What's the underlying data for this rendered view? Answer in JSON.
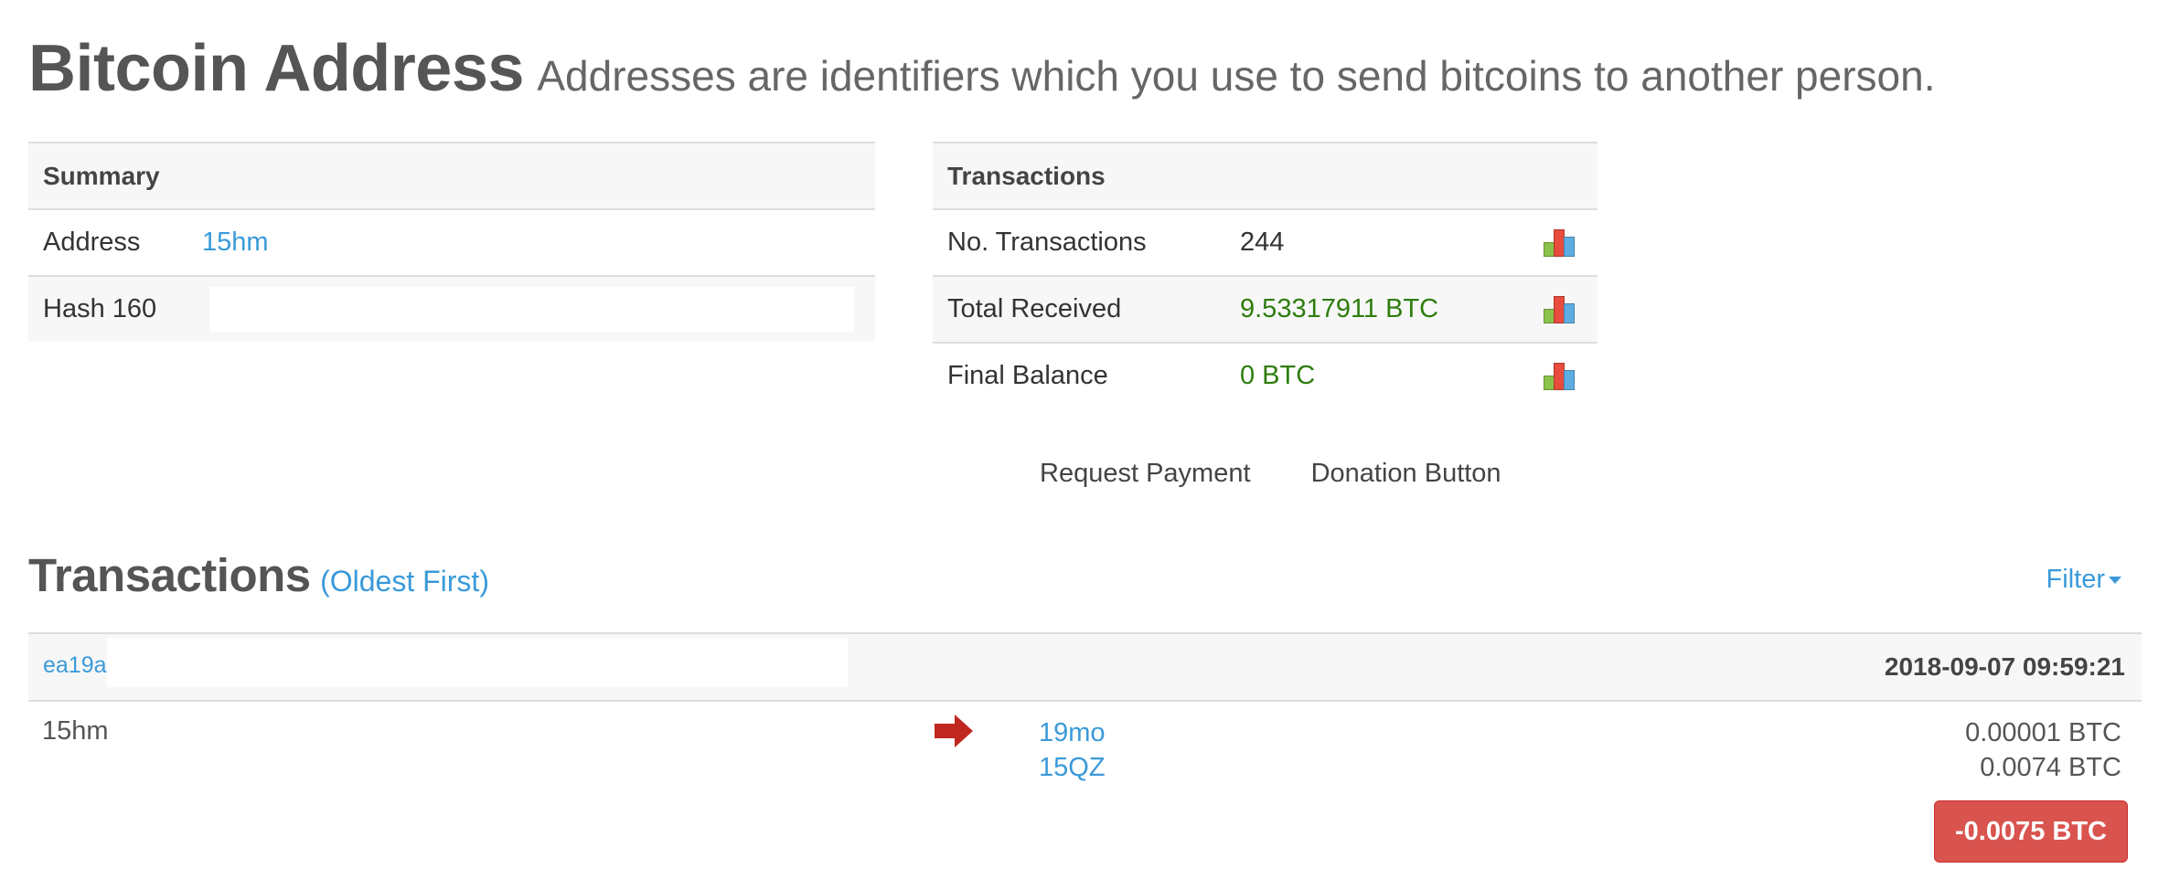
{
  "header": {
    "title": "Bitcoin Address",
    "subtitle": "Addresses are identifiers which you use to send bitcoins to another person."
  },
  "summary": {
    "heading": "Summary",
    "address_label": "Address",
    "address_value": "15hm",
    "hash160_label": "Hash 160",
    "hash160_value": ""
  },
  "transactions_box": {
    "heading": "Transactions",
    "rows": [
      {
        "label": "No. Transactions",
        "value": "244",
        "icon": "bar-chart-icon"
      },
      {
        "label": "Total Received",
        "value": "9.53317911 BTC",
        "icon": "bar-chart-icon"
      },
      {
        "label": "Final Balance",
        "value": "0 BTC",
        "icon": "bar-chart-icon"
      }
    ]
  },
  "actions": {
    "request_payment": "Request Payment",
    "donation_button": "Donation Button"
  },
  "tx_section": {
    "title": "Transactions",
    "order": "(Oldest First)",
    "filter": "Filter"
  },
  "tx": {
    "hash": "ea19a",
    "time": "2018-09-07 09:59:21",
    "from": "15hm",
    "outputs": [
      {
        "address": "19mo",
        "amount": "0.00001 BTC"
      },
      {
        "address": "15QZ",
        "amount": "0.0074 BTC"
      }
    ],
    "net": "-0.0075 BTC"
  },
  "colors": {
    "link": "#3a9ad9",
    "positive": "#2e7d0e",
    "negative_badge": "#d9534f",
    "arrow": "#c0281f"
  }
}
